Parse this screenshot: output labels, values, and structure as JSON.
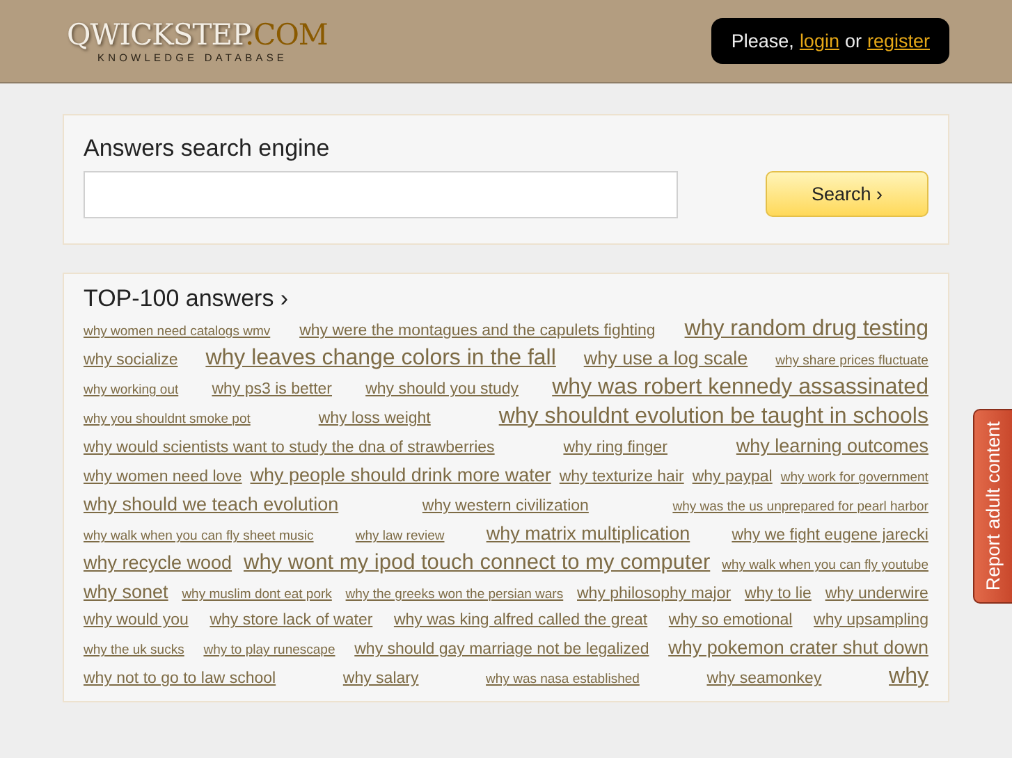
{
  "header": {
    "logo": {
      "name": "QWICKSTEP",
      "suffix": ".COM",
      "tagline": "KNOWLEDGE DATABASE"
    },
    "auth": {
      "prefix": "Please,",
      "login": "login",
      "joiner": "or",
      "register": "register"
    }
  },
  "search": {
    "title": "Answers search engine",
    "button": "Search ›"
  },
  "top": {
    "title": "TOP-100 answers ›",
    "tags": [
      {
        "text": "why women need catalogs wmv",
        "kind": "xs"
      },
      {
        "text": "why were the montagues and the capulets fighting",
        "kind": "s"
      },
      {
        "text": "why random drug testing",
        "kind": "xl"
      },
      {
        "text": "why socialize",
        "kind": "s"
      },
      {
        "text": "why leaves change colors in the fall",
        "kind": "xl"
      },
      {
        "text": "why use a log scale",
        "kind": "m"
      },
      {
        "text": "why share prices fluctuate",
        "kind": "xs"
      },
      {
        "text": "why working out",
        "kind": "xs"
      },
      {
        "text": "why ps3 is better",
        "kind": "s"
      },
      {
        "text": "why should you study",
        "kind": "s"
      },
      {
        "text": "why was robert kennedy assassinated",
        "kind": "xl"
      },
      {
        "text": "why you shouldnt smoke pot",
        "kind": "xs"
      },
      {
        "text": "why loss weight",
        "kind": "s"
      },
      {
        "text": "why shouldnt evolution be taught in schools",
        "kind": "xl"
      },
      {
        "text": "why would scientists want to study the dna of strawberries",
        "kind": "s"
      },
      {
        "text": "why ring finger",
        "kind": "s"
      },
      {
        "text": "why learning outcomes",
        "kind": "m"
      },
      {
        "text": "why women need love",
        "kind": "s"
      },
      {
        "text": "why people should drink more water",
        "kind": "m"
      },
      {
        "text": "why texturize hair",
        "kind": "s"
      },
      {
        "text": "why paypal",
        "kind": "s"
      },
      {
        "text": "why work for government",
        "kind": "xs"
      },
      {
        "text": "why should we teach evolution",
        "kind": "m"
      },
      {
        "text": "why western civilization",
        "kind": "s"
      },
      {
        "text": "why was the us unprepared for pearl harbor",
        "kind": "xs"
      },
      {
        "text": "why walk when you can fly sheet music",
        "kind": "xs"
      },
      {
        "text": "why law review",
        "kind": "xs"
      },
      {
        "text": "why matrix multiplication",
        "kind": "m"
      },
      {
        "text": "why we fight eugene jarecki",
        "kind": "s"
      },
      {
        "text": "why recycle wood",
        "kind": "m"
      },
      {
        "text": "why wont my ipod touch connect to my computer",
        "kind": "l"
      },
      {
        "text": "why walk when you can fly youtube",
        "kind": "xs"
      },
      {
        "text": "why sonet",
        "kind": "m"
      },
      {
        "text": "why muslim dont eat pork",
        "kind": "xs"
      },
      {
        "text": "why the greeks won the persian wars",
        "kind": "xs"
      },
      {
        "text": "why philosophy major",
        "kind": "s"
      },
      {
        "text": "why to lie",
        "kind": "s"
      },
      {
        "text": "why underwire",
        "kind": "s"
      },
      {
        "text": "why would you",
        "kind": "s"
      },
      {
        "text": "why store lack of water",
        "kind": "s"
      },
      {
        "text": "why was king alfred called the great",
        "kind": "s"
      },
      {
        "text": "why so emotional",
        "kind": "s"
      },
      {
        "text": "why upsampling",
        "kind": "s"
      },
      {
        "text": "why the uk sucks",
        "kind": "xs"
      },
      {
        "text": "why to play runescape",
        "kind": "xs"
      },
      {
        "text": "why should gay marriage not be legalized",
        "kind": "s"
      },
      {
        "text": "why pokemon crater shut down",
        "kind": "m"
      },
      {
        "text": "why not to go to law school",
        "kind": "s"
      },
      {
        "text": "why salary",
        "kind": "s"
      },
      {
        "text": "why was nasa established",
        "kind": "xs"
      },
      {
        "text": "why seamonkey",
        "kind": "s"
      },
      {
        "text": "why",
        "kind": "xl"
      }
    ]
  },
  "report": {
    "label": "Report adult content"
  }
}
